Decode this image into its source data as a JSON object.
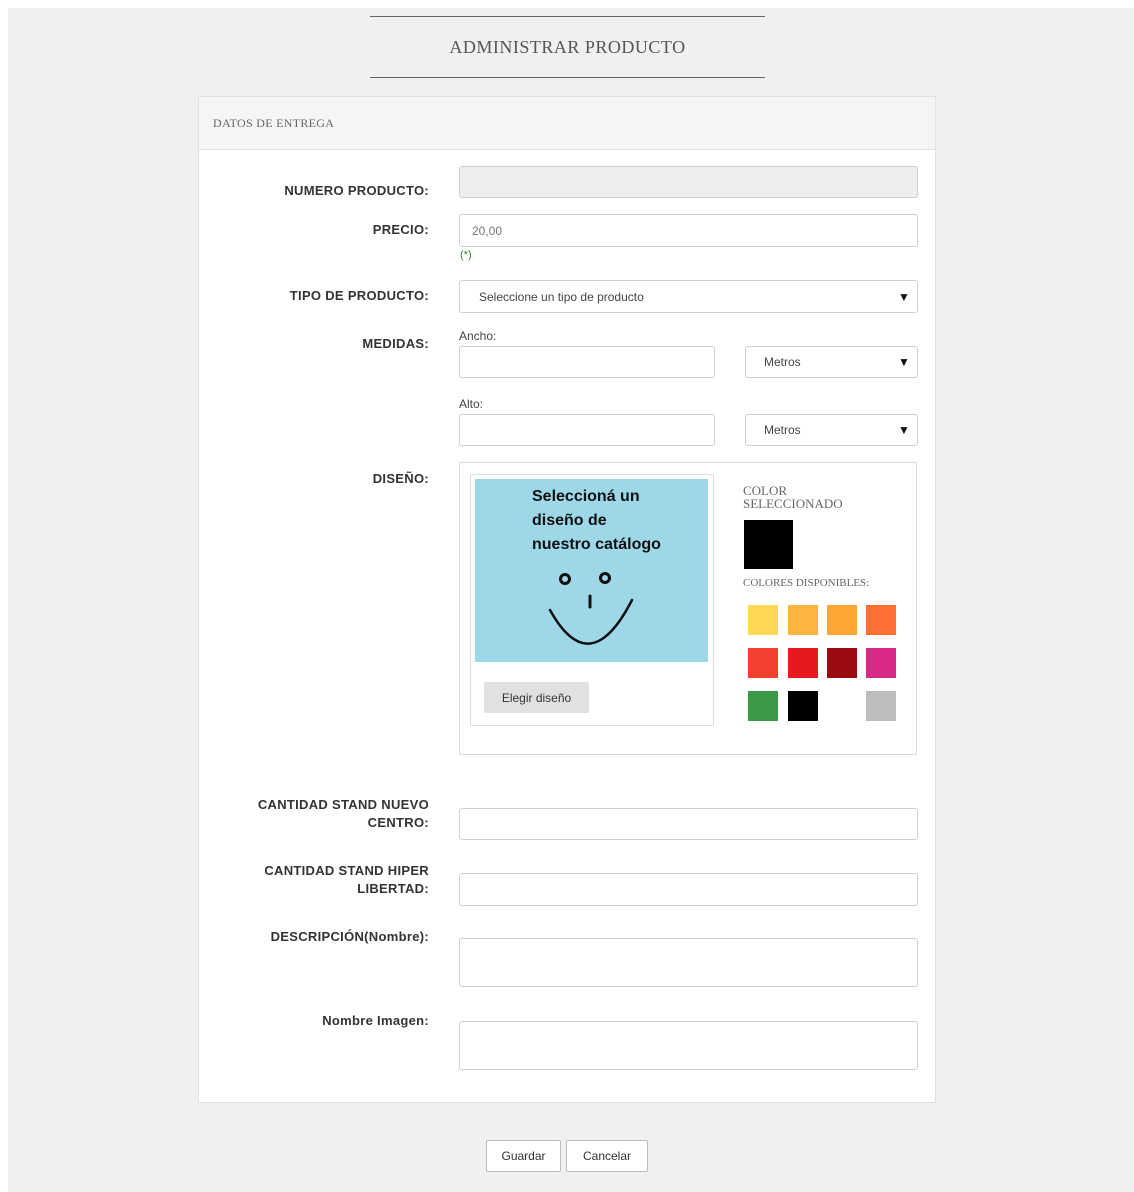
{
  "header": {
    "title": "ADMINISTRAR PRODUCTO"
  },
  "card": {
    "title": "DATOS DE ENTREGA"
  },
  "fields": {
    "numero_label": "NUMERO PRODUCTO:",
    "numero_value": "",
    "precio_label": "PRECIO:",
    "precio_value": "20,00",
    "precio_required": "(*)",
    "tipo_label": "TIPO DE PRODUCTO:",
    "tipo_selected": "Seleccione un tipo de producto",
    "medidas_label": "MEDIDAS:",
    "ancho_label": "Ancho:",
    "ancho_value": "",
    "ancho_unit": "Metros",
    "alto_label": "Alto:",
    "alto_value": "",
    "alto_unit": "Metros",
    "diseno_label": "DISEÑO:",
    "stand_nuevo_label_1": "CANTIDAD STAND NUEVO",
    "stand_nuevo_label_2": "CENTRO:",
    "stand_nuevo_value": "",
    "stand_hiper_label_1": "CANTIDAD STAND HIPER",
    "stand_hiper_label_2": "LIBERTAD:",
    "stand_hiper_value": "",
    "descripcion_label": "DESCRIPCIÓN(Nombre):",
    "descripcion_value": "",
    "imagen_label": "Nombre Imagen:",
    "imagen_value": ""
  },
  "design": {
    "image_text_1": "Seleccioná un",
    "image_text_2": "diseño de",
    "image_text_3": "nuestro catálogo",
    "pick_button": "Elegir diseño",
    "selected_title_1": "COLOR",
    "selected_title_2": "SELECCIONADO",
    "selected_color": "#000000",
    "available_title": "COLORES DISPONIBLES:",
    "available_colors": [
      "#ffd855",
      "#ffb340",
      "#ffa533",
      "#ff6f33",
      "#f5402f",
      "#e8181f",
      "#9b0a10",
      "#d92a88",
      "#3a9a47",
      "#000000",
      "#ffffff",
      "#bdbdbd"
    ]
  },
  "actions": {
    "save": "Guardar",
    "cancel": "Cancelar"
  }
}
